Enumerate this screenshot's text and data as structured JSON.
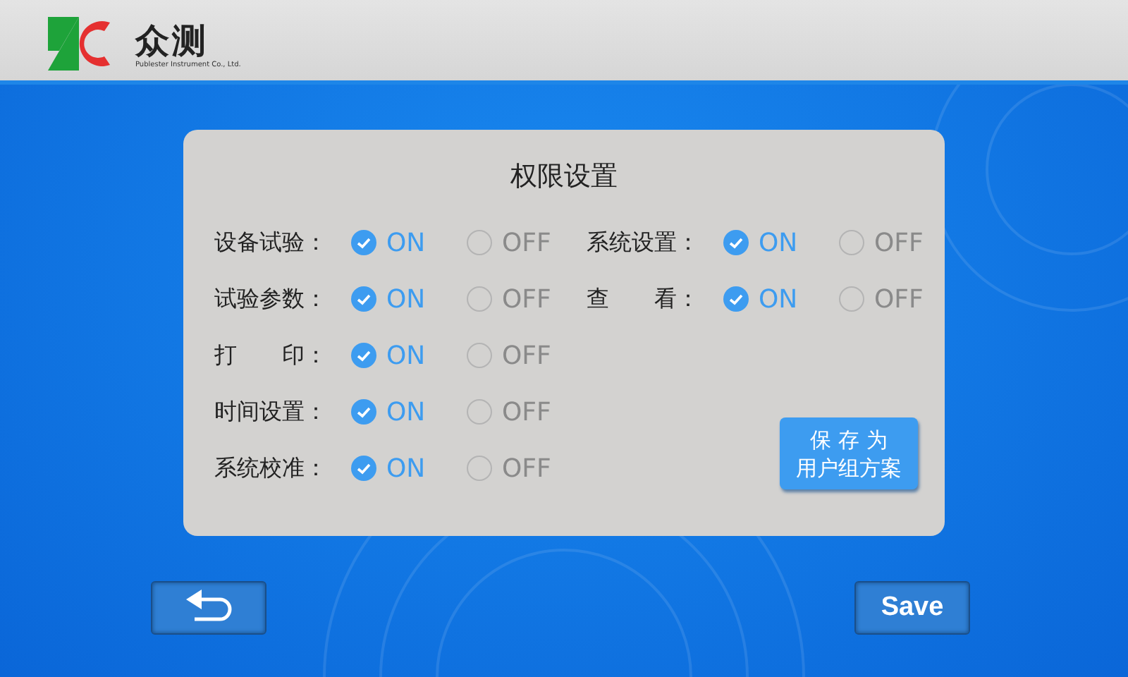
{
  "header": {
    "logo_name": "众测",
    "logo_subtitle": "Publester Instrument Co., Ltd."
  },
  "panel": {
    "title": "权限设置",
    "left_permissions": [
      {
        "label": "设备试验：",
        "options": [
          {
            "label": "ON",
            "selected": true
          },
          {
            "label": "OFF",
            "selected": false
          }
        ]
      },
      {
        "label": "试验参数：",
        "options": [
          {
            "label": "ON",
            "selected": true
          },
          {
            "label": "OFF",
            "selected": false
          }
        ]
      },
      {
        "label": "打　　印：",
        "options": [
          {
            "label": "ON",
            "selected": true
          },
          {
            "label": "OFF",
            "selected": false
          }
        ]
      },
      {
        "label": "时间设置：",
        "options": [
          {
            "label": "ON",
            "selected": true
          },
          {
            "label": "OFF",
            "selected": false
          }
        ]
      },
      {
        "label": "系统校准：",
        "options": [
          {
            "label": "ON",
            "selected": true
          },
          {
            "label": "OFF",
            "selected": false
          }
        ]
      }
    ],
    "right_permissions": [
      {
        "label": "系统设置：",
        "options": [
          {
            "label": "ON",
            "selected": true
          },
          {
            "label": "OFF",
            "selected": false
          }
        ]
      },
      {
        "label": "查　　看：",
        "options": [
          {
            "label": "ON",
            "selected": true
          },
          {
            "label": "OFF",
            "selected": false
          }
        ]
      }
    ],
    "save_as_button": [
      "保 存 为",
      "用户组方案"
    ]
  },
  "footer": {
    "save_button": "Save"
  }
}
